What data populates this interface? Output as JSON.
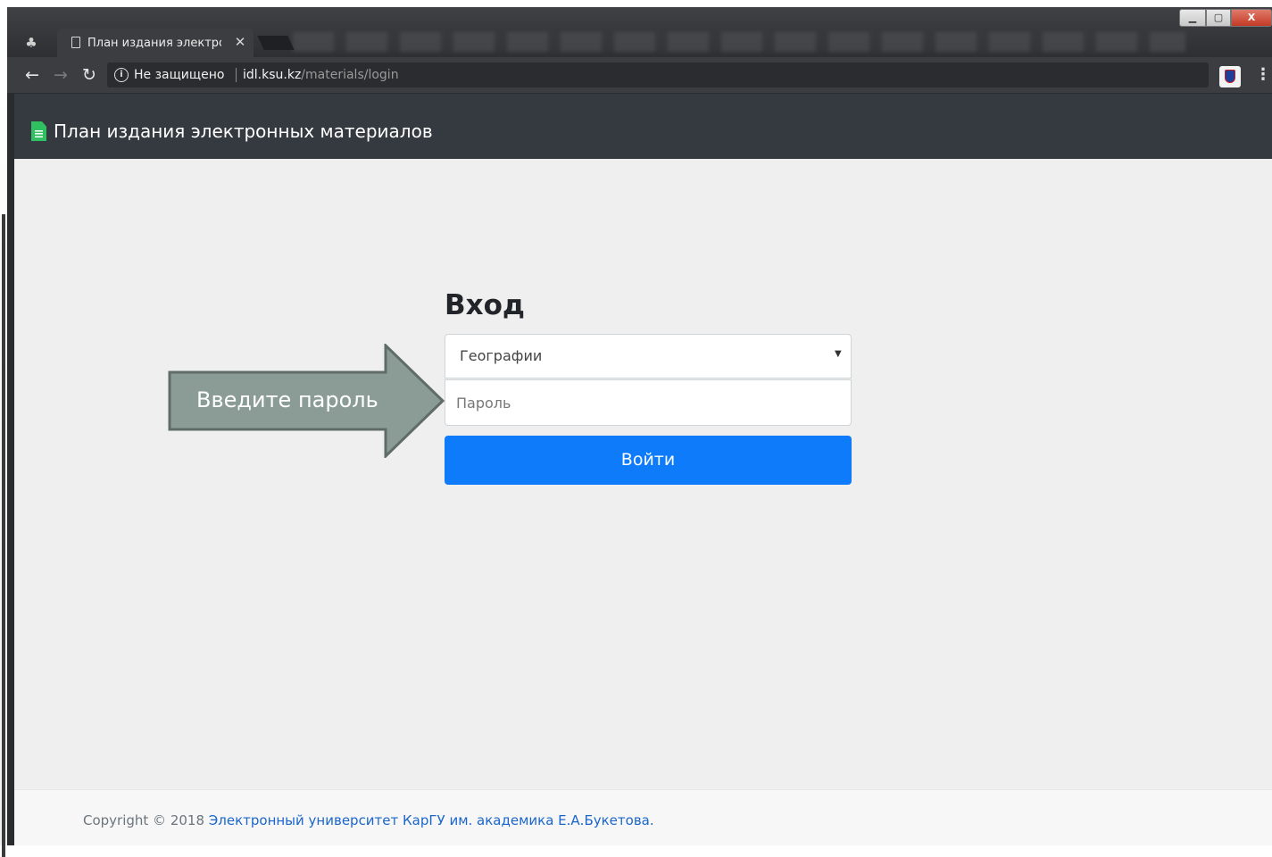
{
  "browser": {
    "tab_title": "План издания электрон",
    "tab_close": "✕",
    "security_label": "Не защищено",
    "url_host": "idl.ksu.kz",
    "url_path": "/materials/login",
    "icons": {
      "incognito": "incognito-icon",
      "back": "back-arrow-icon",
      "forward": "forward-arrow-icon",
      "reload": "reload-icon",
      "info": "info-icon",
      "extension": "shield-extension-icon",
      "menu": "kebab-menu-icon"
    },
    "window_controls": {
      "minimize": "▁",
      "maximize": "▢",
      "close": "X"
    }
  },
  "site": {
    "title": "План издания электронных материалов",
    "logo_icon": "document-icon",
    "header_color": "#343a40"
  },
  "login": {
    "heading": "Вход",
    "faculty_select_value": "Географии",
    "password_placeholder": "Пароль",
    "submit_label": "Войти",
    "button_color": "#0d7bfa"
  },
  "annotation": {
    "text": "Введите пароль",
    "fill_color": "#8a9c95"
  },
  "footer": {
    "copyright": "Copyright © 2018 ",
    "link_text": "Электронный университет КарГУ им. академика Е.А.Букетова."
  }
}
